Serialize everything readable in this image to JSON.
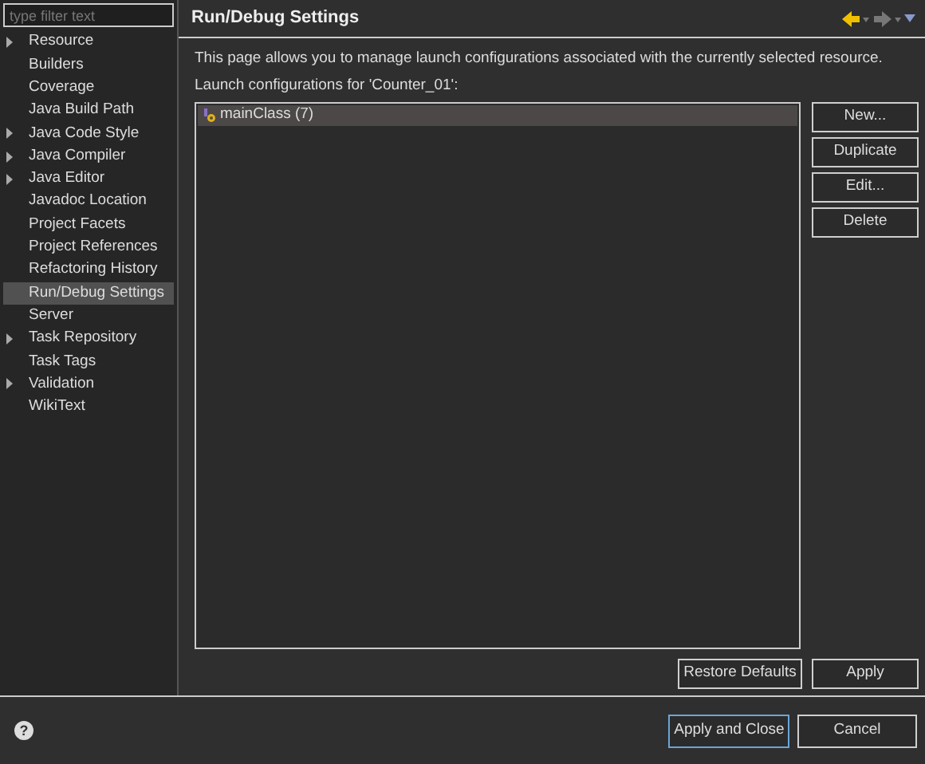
{
  "filter": {
    "placeholder": "type filter text"
  },
  "sidebar": {
    "items": [
      {
        "label": "Resource",
        "expandable": true,
        "selected": false
      },
      {
        "label": "Builders",
        "expandable": false,
        "selected": false
      },
      {
        "label": "Coverage",
        "expandable": false,
        "selected": false
      },
      {
        "label": "Java Build Path",
        "expandable": false,
        "selected": false
      },
      {
        "label": "Java Code Style",
        "expandable": true,
        "selected": false
      },
      {
        "label": "Java Compiler",
        "expandable": true,
        "selected": false
      },
      {
        "label": "Java Editor",
        "expandable": true,
        "selected": false
      },
      {
        "label": "Javadoc Location",
        "expandable": false,
        "selected": false
      },
      {
        "label": "Project Facets",
        "expandable": false,
        "selected": false
      },
      {
        "label": "Project References",
        "expandable": false,
        "selected": false
      },
      {
        "label": "Refactoring History",
        "expandable": false,
        "selected": false
      },
      {
        "label": "Run/Debug Settings",
        "expandable": false,
        "selected": true
      },
      {
        "label": "Server",
        "expandable": false,
        "selected": false
      },
      {
        "label": "Task Repository",
        "expandable": true,
        "selected": false
      },
      {
        "label": "Task Tags",
        "expandable": false,
        "selected": false
      },
      {
        "label": "Validation",
        "expandable": true,
        "selected": false
      },
      {
        "label": "WikiText",
        "expandable": false,
        "selected": false
      }
    ]
  },
  "page": {
    "title": "Run/Debug Settings",
    "description": "This page allows you to manage launch configurations associated with the currently selected resource.",
    "list_label": "Launch configurations for 'Counter_01':",
    "configurations": [
      {
        "label": "mainClass (7)",
        "selected": true
      }
    ],
    "side_buttons": [
      "New...",
      "Duplicate",
      "Edit...",
      "Delete"
    ],
    "restore_button": "Restore Defaults",
    "apply_button": "Apply"
  },
  "footer": {
    "help": "?",
    "buttons": [
      {
        "label": "Apply and Close",
        "kind": "default"
      },
      {
        "label": "Cancel",
        "kind": "normal"
      }
    ]
  }
}
